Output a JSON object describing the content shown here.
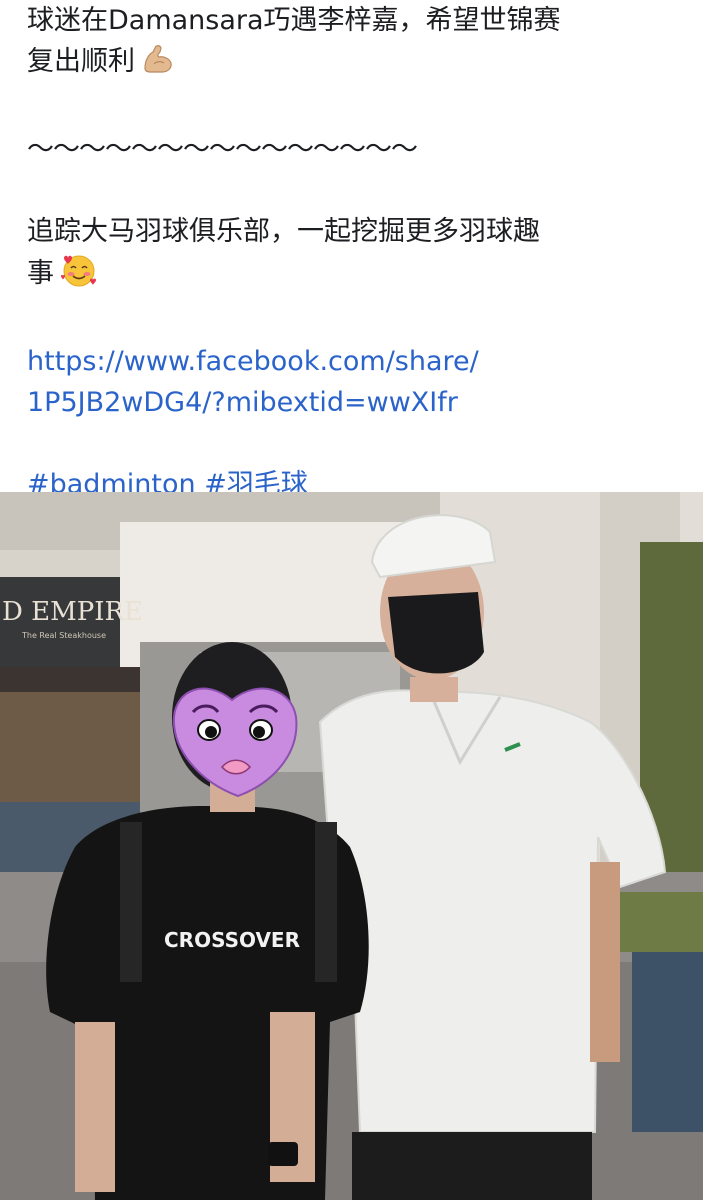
{
  "post": {
    "line1": "球迷在Damansara巧遇李梓嘉，希望世锦赛",
    "line2": "复出顺利",
    "line2_emoji": "flexed-biceps-emoji",
    "divider": "～～～～～～～～～～～～～～～",
    "follow_line1": "追踪大马羽球俱乐部，一起挖掘更多羽球趣",
    "follow_line2": "事",
    "follow_emoji": "smiling-face-with-hearts-emoji",
    "link_line1": "https://www.facebook.com/share/",
    "link_line2": "1P5JB2wDG4/?mibextid=wwXIfr",
    "hashtag_1": "#badminton",
    "hashtag_2": "#羽毛球"
  },
  "photo": {
    "store_sign": "D EMPIRE",
    "store_sign_sub": "The Real Steakhouse",
    "shirt_text": "CROSSOVER",
    "sticker_icon": "pink-heart-face-sticker"
  },
  "colors": {
    "text": "#1c1e21",
    "link": "#2a63c9",
    "background": "#ffffff"
  }
}
